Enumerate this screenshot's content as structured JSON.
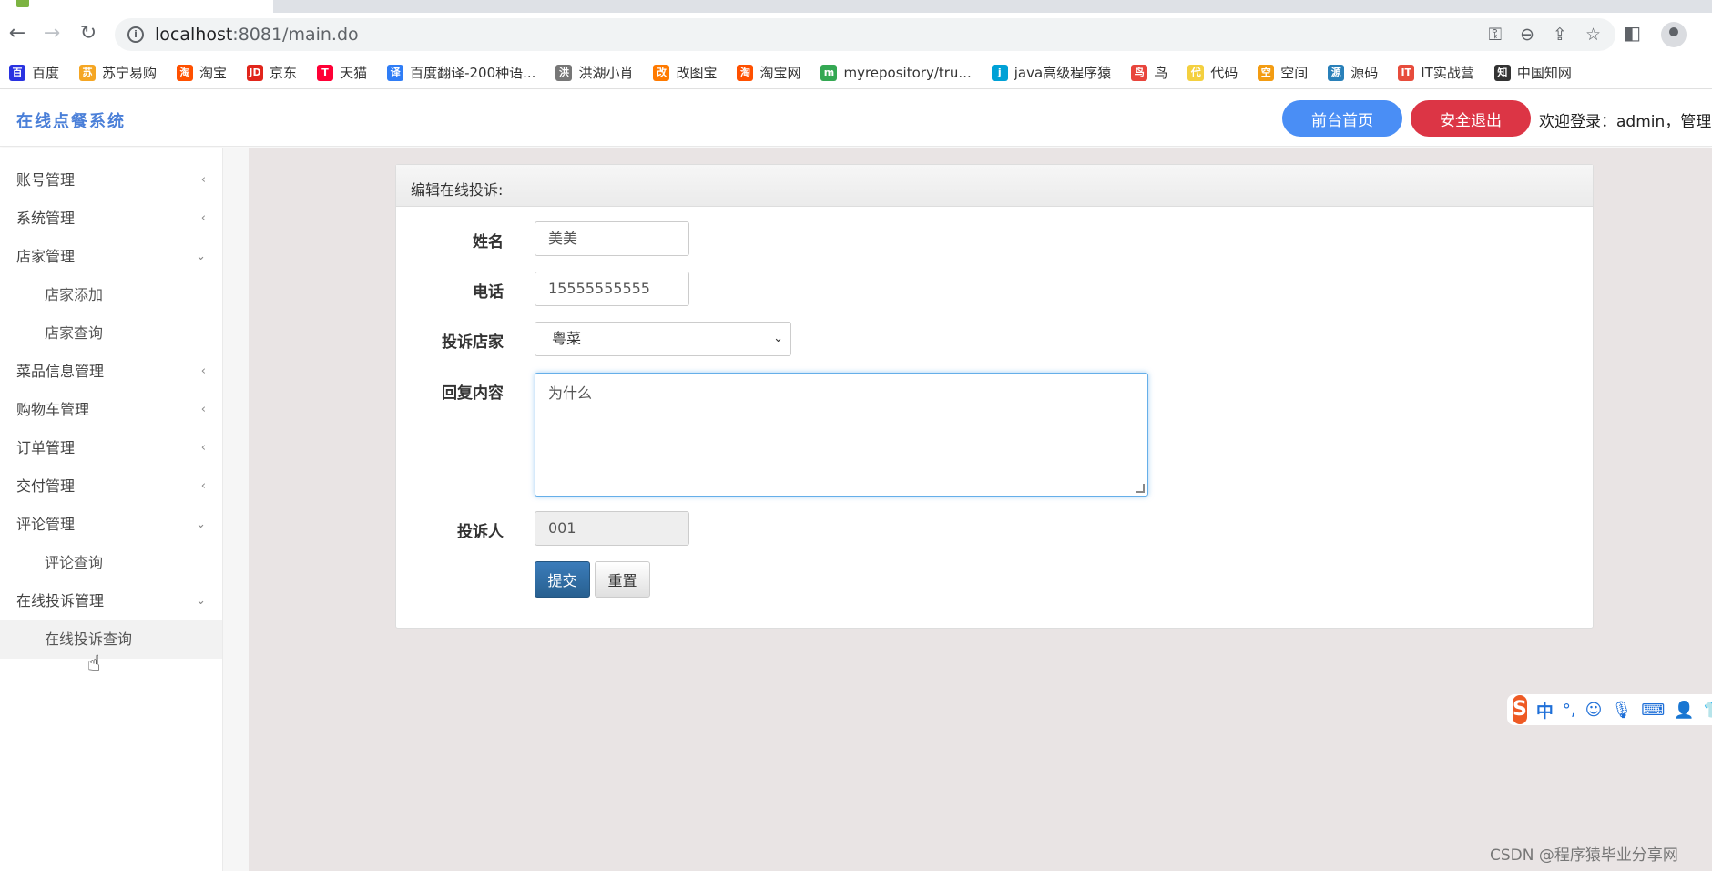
{
  "browser": {
    "url_host": "localhost",
    "url_rest": ":8081/main.do"
  },
  "bookmarks": [
    {
      "label": "百度",
      "color": "#2932e1",
      "glyph": "百"
    },
    {
      "label": "苏宁易购",
      "color": "#f5a623",
      "glyph": "苏"
    },
    {
      "label": "淘宝",
      "color": "#ff5000",
      "glyph": "淘"
    },
    {
      "label": "京东",
      "color": "#e1251b",
      "glyph": "JD"
    },
    {
      "label": "天猫",
      "color": "#ff0036",
      "glyph": "T"
    },
    {
      "label": "百度翻译-200种语...",
      "color": "#2f7df6",
      "glyph": "译"
    },
    {
      "label": "洪湖小肖",
      "color": "#777777",
      "glyph": "洪"
    },
    {
      "label": "改图宝",
      "color": "#ff7a00",
      "glyph": "改"
    },
    {
      "label": "淘宝网",
      "color": "#ff5000",
      "glyph": "淘"
    },
    {
      "label": "myrepository/tru...",
      "color": "#34a853",
      "glyph": "m"
    },
    {
      "label": "java高级程序猿",
      "color": "#00a1d6",
      "glyph": "j"
    },
    {
      "label": "鸟",
      "color": "#e8453c",
      "glyph": "鸟"
    },
    {
      "label": "代码",
      "color": "#f4d03f",
      "glyph": "代"
    },
    {
      "label": "空间",
      "color": "#f39c12",
      "glyph": "空"
    },
    {
      "label": "源码",
      "color": "#2980b9",
      "glyph": "源"
    },
    {
      "label": "IT实战营",
      "color": "#e74c3c",
      "glyph": "IT"
    },
    {
      "label": "中国知网",
      "color": "#333333",
      "glyph": "知"
    }
  ],
  "header": {
    "brand": "在线点餐系统",
    "home_button": "前台首页",
    "logout_button": "安全退出",
    "welcome": "欢迎登录：admin，管理员"
  },
  "sidebar": {
    "items": [
      {
        "label": "账号管理",
        "chevron": "‹"
      },
      {
        "label": "系统管理",
        "chevron": "‹"
      },
      {
        "label": "店家管理",
        "chevron": "⌄"
      },
      {
        "label": "店家添加"
      },
      {
        "label": "店家查询"
      },
      {
        "label": "菜品信息管理",
        "chevron": "‹"
      },
      {
        "label": "购物车管理",
        "chevron": "‹"
      },
      {
        "label": "订单管理",
        "chevron": "‹"
      },
      {
        "label": "交付管理",
        "chevron": "‹"
      },
      {
        "label": "评论管理",
        "chevron": "⌄"
      },
      {
        "label": "评论查询"
      },
      {
        "label": "在线投诉管理",
        "chevron": "⌄"
      },
      {
        "label": "在线投诉查询"
      }
    ]
  },
  "form": {
    "title": "编辑在线投诉:",
    "name_label": "姓名",
    "name_value": "美美",
    "phone_label": "电话",
    "phone_value": "15555555555",
    "store_label": "投诉店家",
    "store_value": "粤菜",
    "reply_label": "回复内容",
    "reply_value": "为什么",
    "complainant_label": "投诉人",
    "complainant_value": "001",
    "submit": "提交",
    "reset": "重置"
  },
  "ime": {
    "mode": "中",
    "punct": "°,"
  },
  "watermark": "CSDN @程序猿毕业分享网"
}
